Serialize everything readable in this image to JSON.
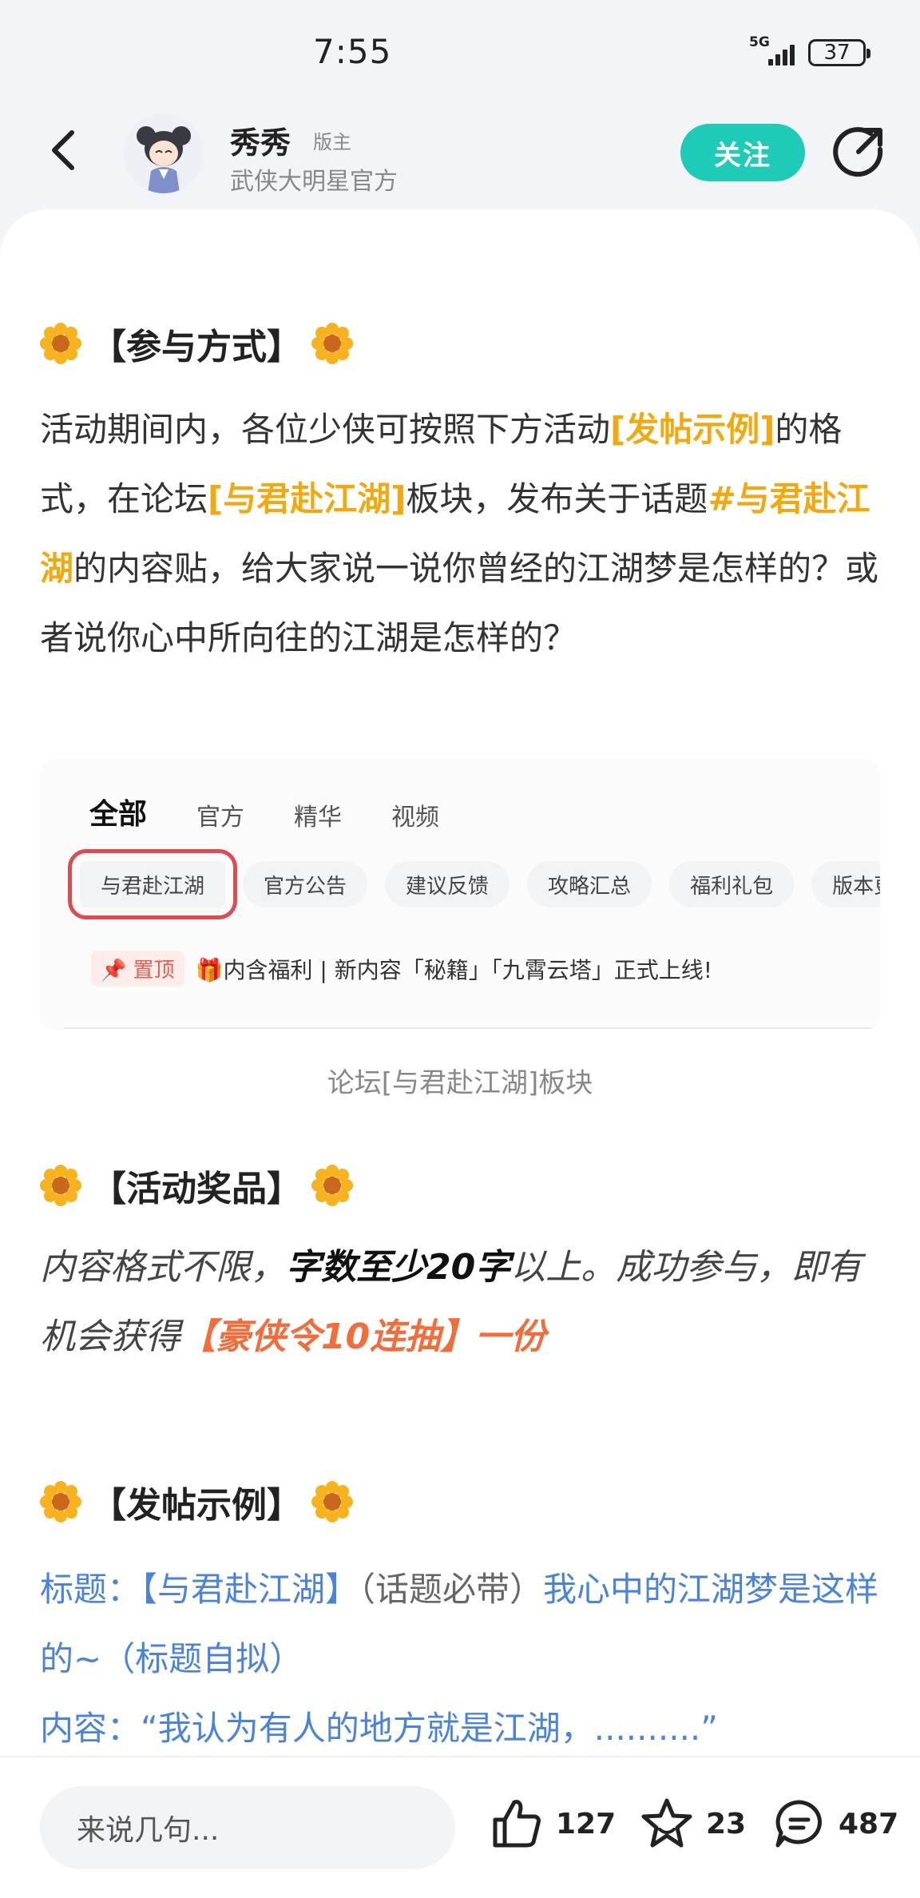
{
  "status_bar": {
    "time": "7:55",
    "network": "5G",
    "battery": "37"
  },
  "header": {
    "author_name": "秀秀",
    "author_badge": "版主",
    "author_sub": "武侠大明星官方",
    "follow_label": "关注"
  },
  "post": {
    "section1": {
      "title": "【参与方式】",
      "p1": "活动期间内，各位少侠可按照下方活动",
      "h1": "[发帖示例]",
      "p2": "的格式，在论坛",
      "h2": "[与君赴江湖]",
      "p3": "板块，发布关于话题",
      "h3": "#与君赴江湖",
      "p4": "的内容贴，给大家说一说你曾经的江湖梦是怎样的？或者说你心中所向往的江湖是怎样的？"
    },
    "screenshot": {
      "tabs": [
        "全部",
        "官方",
        "精华",
        "视频"
      ],
      "chips": [
        "与君赴江湖",
        "官方公告",
        "建议反馈",
        "攻略汇总",
        "福利礼包",
        "版本更新"
      ],
      "pin_label": "置顶",
      "pin_text": "🎁内含福利 | 新内容「秘籍」「九霄云塔」正式上线!"
    },
    "caption": "论坛[与君赴江湖]板块",
    "section2": {
      "title": "【活动奖品】",
      "t1": "内容格式不限，",
      "t2": "字数至少20字",
      "t3": "以上。成功参与，即有机会获得",
      "t4": "【豪侠令10连抽】一份"
    },
    "section3": {
      "title": "【发帖示例】",
      "l1a": "标题：【与君赴江湖】",
      "l1b": "（话题必带）",
      "l1c": "我心中的江湖梦是这样的~（标题自拟）",
      "l2": "内容：“我认为有人的地方就是江湖，..........”"
    }
  },
  "bottom_bar": {
    "comment_placeholder": "来说几句...",
    "likes": "127",
    "favorites": "23",
    "comments": "487"
  },
  "colors": {
    "accent": "#1ecbb6",
    "highlight": "#f2a90f",
    "prize": "#f36d3b",
    "link": "#4a83dd"
  }
}
